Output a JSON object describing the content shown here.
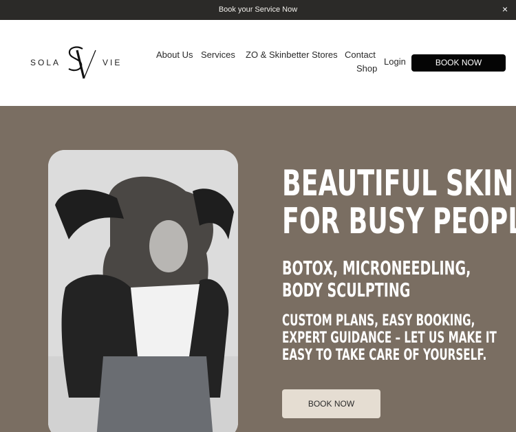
{
  "announcement": {
    "text": "Book your Service Now",
    "close_icon": "close-icon"
  },
  "brand": {
    "left": "SOLA",
    "right": "VIE",
    "monogram": "SV"
  },
  "nav": {
    "about": "About Us",
    "services": "Services",
    "stores": "ZO & Skinbetter Stores",
    "contact": "Contact",
    "shop": "Shop",
    "login": "Login",
    "book": "BOOK NOW"
  },
  "hero": {
    "headline_line1": "BEAUTIFUL SKIN",
    "headline_line2": "FOR BUSY PEOPLE",
    "subheading": "BOTOX, MICRONEEDLING, BODY SCULPTING",
    "tagline": "CUSTOM PLANS, EASY BOOKING, EXPERT GUIDANCE – LET US MAKE IT EASY TO TAKE CARE OF YOURSELF.",
    "cta": "BOOK NOW"
  },
  "colors": {
    "announcement_bg": "#2b2a28",
    "hero_bg": "#7a6e62",
    "primary_button": "#050505",
    "hero_button": "#e5ddd2"
  }
}
